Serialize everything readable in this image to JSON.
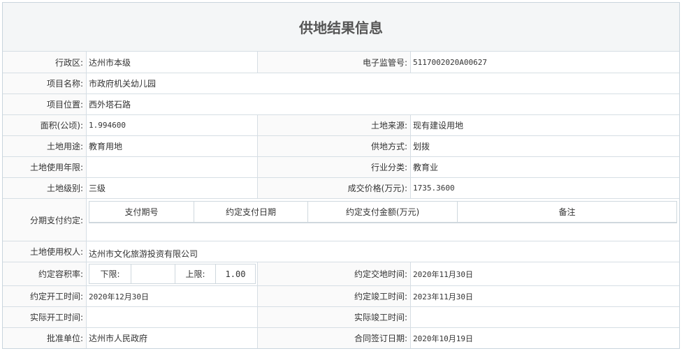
{
  "title": "供地结果信息",
  "rows": {
    "district": {
      "label": "行政区:",
      "value": "达州市本级"
    },
    "supervision_no": {
      "label": "电子监管号:",
      "value": "5117002020A00627"
    },
    "project_name": {
      "label": "项目名称:",
      "value": "市政府机关幼儿园"
    },
    "project_location": {
      "label": "项目位置:",
      "value": "西外塔石路"
    },
    "area": {
      "label": "面积(公顷):",
      "value": "1.994600"
    },
    "land_source": {
      "label": "土地来源:",
      "value": "现有建设用地"
    },
    "land_use": {
      "label": "土地用途:",
      "value": "教育用地"
    },
    "supply_method": {
      "label": "供地方式:",
      "value": "划拨"
    },
    "use_term": {
      "label": "土地使用年限:",
      "value": ""
    },
    "industry": {
      "label": "行业分类:",
      "value": "教育业"
    },
    "land_grade": {
      "label": "土地级别:",
      "value": "三级"
    },
    "price": {
      "label": "成交价格(万元):",
      "value": "1735.3600"
    },
    "installments": {
      "label": "分期支付约定:",
      "headers": [
        "支付期号",
        "约定支付日期",
        "约定支付金额(万元)",
        "备注"
      ]
    },
    "holder": {
      "label": "土地使用权人:",
      "value": "达州市文化旅游投资有限公司"
    },
    "plot_ratio": {
      "label": "约定容积率:",
      "lower_label": "下限:",
      "lower_value": "",
      "upper_label": "上限:",
      "upper_value": "1.00"
    },
    "handover_date": {
      "label": "约定交地时间:",
      "value": "2020年11月30日"
    },
    "start_date": {
      "label": "约定开工时间:",
      "value": "2020年12月30日"
    },
    "completion_date": {
      "label": "约定竣工时间:",
      "value": "2023年11月30日"
    },
    "actual_start": {
      "label": "实际开工时间:",
      "value": ""
    },
    "actual_completion": {
      "label": "实际竣工时间:",
      "value": ""
    },
    "approver": {
      "label": "批准单位:",
      "value": "达州市人民政府"
    },
    "contract_date": {
      "label": "合同签订日期:",
      "value": "2020年10月19日"
    }
  }
}
